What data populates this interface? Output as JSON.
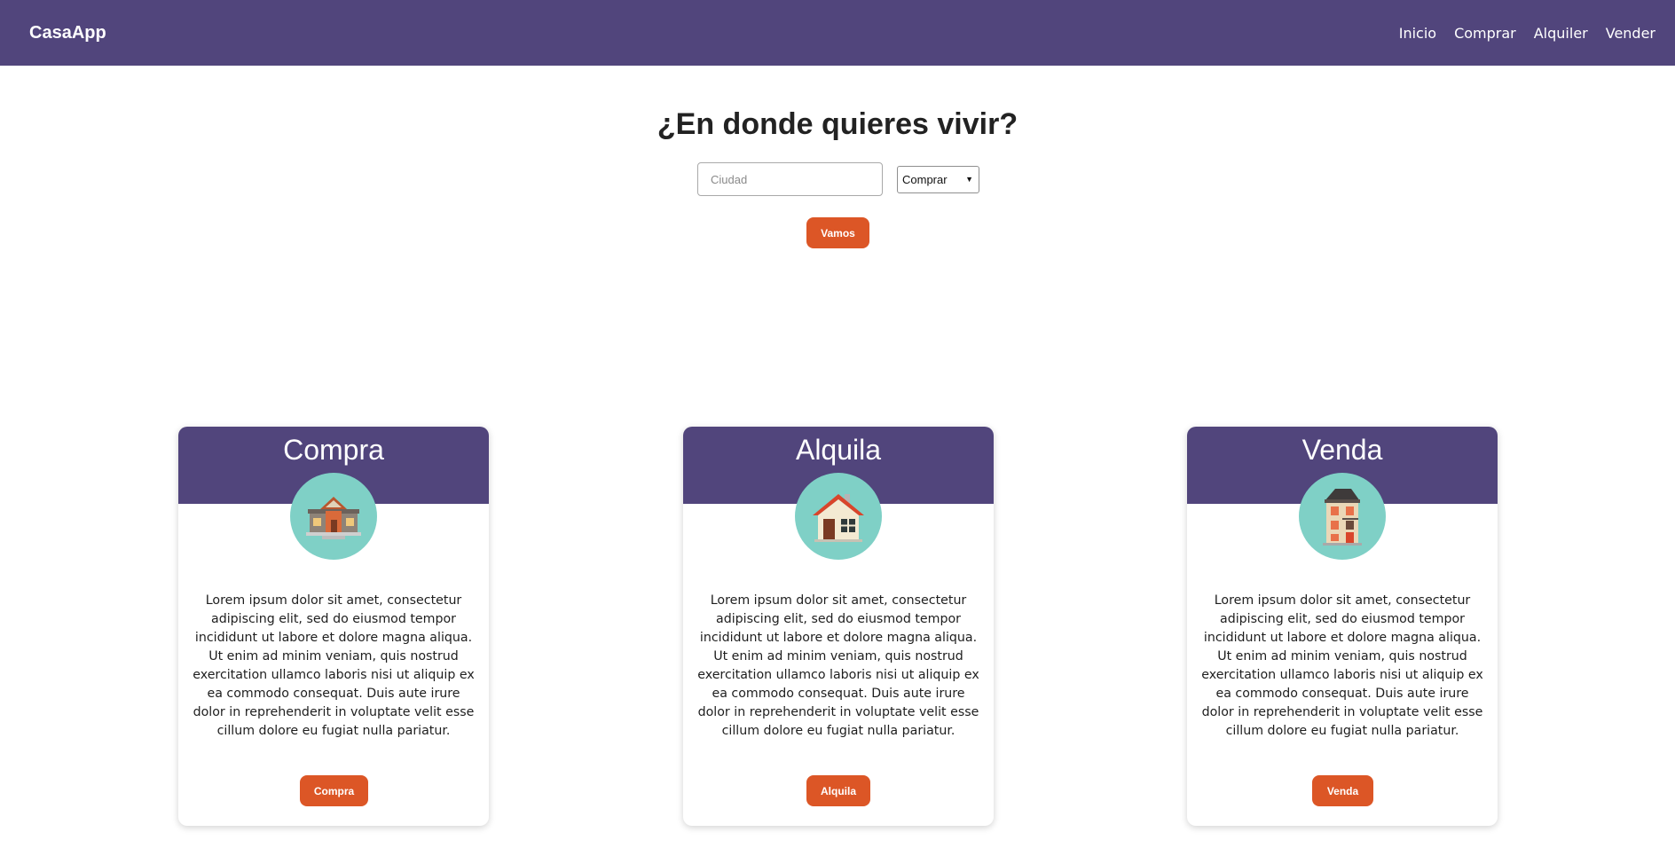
{
  "navbar": {
    "brand": "CasaApp",
    "links": [
      "Inicio",
      "Comprar",
      "Alquiler",
      "Vender"
    ]
  },
  "hero": {
    "title": "¿En donde quieres vivir?",
    "city_placeholder": "Ciudad",
    "operation_selected": "Comprar",
    "go_label": "Vamos"
  },
  "cards": [
    {
      "title": "Compra",
      "icon": "townhouse-icon",
      "text": "Lorem ipsum dolor sit amet, consectetur adipiscing elit, sed do eiusmod tempor incididunt ut labore et dolore magna aliqua. Ut enim ad minim veniam, quis nostrud exercitation ullamco laboris nisi ut aliquip ex ea commodo consequat. Duis aute irure dolor in reprehenderit in voluptate velit esse cillum dolore eu fugiat nulla pariatur.",
      "button": "Compra"
    },
    {
      "title": "Alquila",
      "icon": "cottage-icon",
      "text": "Lorem ipsum dolor sit amet, consectetur adipiscing elit, sed do eiusmod tempor incididunt ut labore et dolore magna aliqua. Ut enim ad minim veniam, quis nostrud exercitation ullamco laboris nisi ut aliquip ex ea commodo consequat. Duis aute irure dolor in reprehenderit in voluptate velit esse cillum dolore eu fugiat nulla pariatur.",
      "button": "Alquila"
    },
    {
      "title": "Venda",
      "icon": "apartment-building-icon",
      "text": "Lorem ipsum dolor sit amet, consectetur adipiscing elit, sed do eiusmod tempor incididunt ut labore et dolore magna aliqua. Ut enim ad minim veniam, quis nostrud exercitation ullamco laboris nisi ut aliquip ex ea commodo consequat. Duis aute irure dolor in reprehenderit in voluptate velit esse cillum dolore eu fugiat nulla pariatur.",
      "button": "Venda"
    }
  ],
  "colors": {
    "primary": "#51457c",
    "accent": "#dc5626",
    "icon_background": "#7fd0c6"
  }
}
